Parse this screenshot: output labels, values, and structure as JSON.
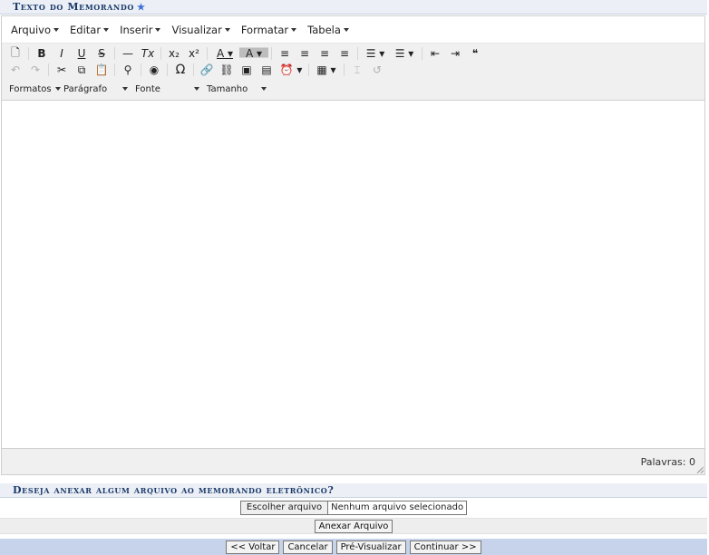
{
  "memo_section": {
    "title": "Texto do Memorando",
    "star": "★"
  },
  "editor": {
    "menu": [
      "Arquivo",
      "Editar",
      "Inserir",
      "Visualizar",
      "Formatar",
      "Tabela"
    ],
    "toolbar_row1": [
      {
        "name": "new-document-icon",
        "glyph": "🗋"
      },
      {
        "name": "sep"
      },
      {
        "name": "bold-icon",
        "glyph": "B"
      },
      {
        "name": "italic-icon",
        "glyph": "I"
      },
      {
        "name": "underline-icon",
        "glyph": "U"
      },
      {
        "name": "strikethrough-icon",
        "glyph": "S"
      },
      {
        "name": "sep"
      },
      {
        "name": "horizontal-rule-icon",
        "glyph": "—"
      },
      {
        "name": "clear-format-icon",
        "glyph": "Tx"
      },
      {
        "name": "sep"
      },
      {
        "name": "subscript-icon",
        "glyph": "x₂"
      },
      {
        "name": "superscript-icon",
        "glyph": "x²"
      },
      {
        "name": "sep"
      },
      {
        "name": "text-color-icon",
        "glyph": "A ▾"
      },
      {
        "name": "background-color-icon",
        "glyph": "A ▾"
      },
      {
        "name": "sep"
      },
      {
        "name": "align-left-icon",
        "glyph": "≡"
      },
      {
        "name": "align-center-icon",
        "glyph": "≡"
      },
      {
        "name": "align-right-icon",
        "glyph": "≡"
      },
      {
        "name": "align-justify-icon",
        "glyph": "≡"
      },
      {
        "name": "sep"
      },
      {
        "name": "bullet-list-icon",
        "glyph": "☰ ▾"
      },
      {
        "name": "numbered-list-icon",
        "glyph": "☰ ▾"
      },
      {
        "name": "sep"
      },
      {
        "name": "outdent-icon",
        "glyph": "⇤"
      },
      {
        "name": "indent-icon",
        "glyph": "⇥"
      },
      {
        "name": "blockquote-icon",
        "glyph": "❝"
      }
    ],
    "toolbar_row2": [
      {
        "name": "undo-icon",
        "glyph": "↶",
        "dim": true
      },
      {
        "name": "redo-icon",
        "glyph": "↷",
        "dim": true
      },
      {
        "name": "sep"
      },
      {
        "name": "cut-icon",
        "glyph": "✂"
      },
      {
        "name": "copy-icon",
        "glyph": "⧉"
      },
      {
        "name": "paste-icon",
        "glyph": "📋"
      },
      {
        "name": "sep"
      },
      {
        "name": "find-replace-icon",
        "glyph": "⚲"
      },
      {
        "name": "sep"
      },
      {
        "name": "preview-icon",
        "glyph": "◉"
      },
      {
        "name": "sep"
      },
      {
        "name": "special-char-icon",
        "glyph": "Ω"
      },
      {
        "name": "sep"
      },
      {
        "name": "link-icon",
        "glyph": "🔗"
      },
      {
        "name": "unlink-icon",
        "glyph": "⛓"
      },
      {
        "name": "image-icon",
        "glyph": "▣"
      },
      {
        "name": "media-icon",
        "glyph": "▤"
      },
      {
        "name": "insert-time-icon",
        "glyph": "⏰ ▾"
      },
      {
        "name": "sep"
      },
      {
        "name": "table-icon",
        "glyph": "▦ ▾"
      },
      {
        "name": "sep"
      },
      {
        "name": "page-break-icon",
        "glyph": "⌶",
        "dim": true
      },
      {
        "name": "restore-draft-icon",
        "glyph": "↺",
        "dim": true
      }
    ],
    "format_selects": [
      "Formatos",
      "Parágrafo",
      "Fonte",
      "Tamanho"
    ],
    "word_count": "Palavras: 0"
  },
  "attach_section": {
    "title": "Deseja anexar algum arquivo ao memorando eletrônico?",
    "choose_file_label": "Escolher arquivo",
    "no_file_label": "Nenhum arquivo selecionado",
    "attach_button": "Anexar Arquivo"
  },
  "footer": {
    "back": "<< Voltar",
    "cancel": "Cancelar",
    "preview": "Pré-Visualizar",
    "continue": "Continuar >>"
  }
}
